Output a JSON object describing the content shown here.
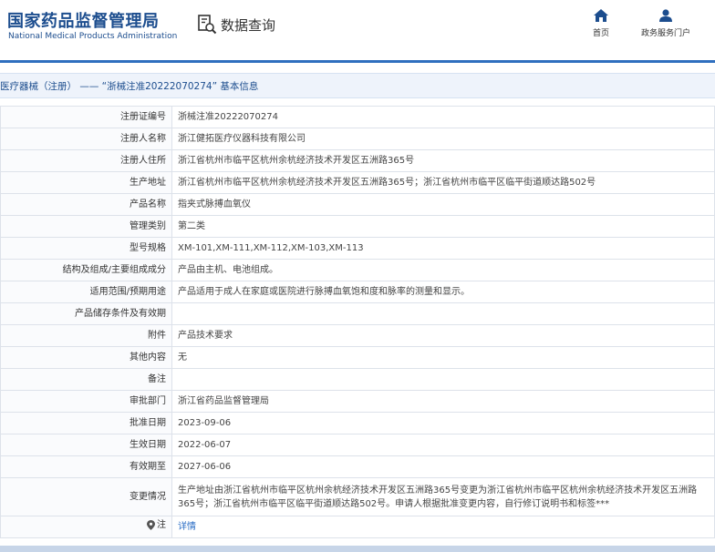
{
  "header": {
    "logo_cn": "国家药品监督管理局",
    "logo_en": "National Medical Products Administration",
    "query_label": "数据查询",
    "query_icon": "document-search-icon",
    "nav": [
      {
        "label": "首页",
        "icon": "home-icon"
      },
      {
        "label": "政务服务门户",
        "icon": "user-icon"
      }
    ],
    "accent_color": "#1c4d8e"
  },
  "breadcrumb": "医疗器械（注册） —— “浙械注准20222070274” 基本信息",
  "details": [
    {
      "label": "注册证编号",
      "value": "浙械注准20222070274"
    },
    {
      "label": "注册人名称",
      "value": "浙江健拓医疗仪器科技有限公司"
    },
    {
      "label": "注册人住所",
      "value": "浙江省杭州市临平区杭州余杭经济技术开发区五洲路365号"
    },
    {
      "label": "生产地址",
      "value": "浙江省杭州市临平区杭州余杭经济技术开发区五洲路365号；浙江省杭州市临平区临平街道顺达路502号"
    },
    {
      "label": "产品名称",
      "value": "指夹式脉搏血氧仪"
    },
    {
      "label": "管理类别",
      "value": "第二类"
    },
    {
      "label": "型号规格",
      "value": "XM-101,XM-111,XM-112,XM-103,XM-113"
    },
    {
      "label": "结构及组成/主要组成成分",
      "value": "产品由主机、电池组成。"
    },
    {
      "label": "适用范围/预期用途",
      "value": "产品适用于成人在家庭或医院进行脉搏血氧饱和度和脉率的测量和显示。"
    },
    {
      "label": "产品储存条件及有效期",
      "value": ""
    },
    {
      "label": "附件",
      "value": "产品技术要求"
    },
    {
      "label": "其他内容",
      "value": "无"
    },
    {
      "label": "备注",
      "value": ""
    },
    {
      "label": "审批部门",
      "value": "浙江省药品监督管理局"
    },
    {
      "label": "批准日期",
      "value": "2023-09-06"
    },
    {
      "label": "生效日期",
      "value": "2022-06-07"
    },
    {
      "label": "有效期至",
      "value": "2027-06-06"
    },
    {
      "label": "变更情况",
      "value": "生产地址由浙江省杭州市临平区杭州余杭经济技术开发区五洲路365号变更为浙江省杭州市临平区杭州余杭经济技术开发区五洲路365号；浙江省杭州市临平区临平街道顺达路502号。申请人根据批准变更内容，自行修订说明书和标签***"
    }
  ],
  "note": {
    "label": "注",
    "icon": "location-pin-icon",
    "link": "详情"
  }
}
